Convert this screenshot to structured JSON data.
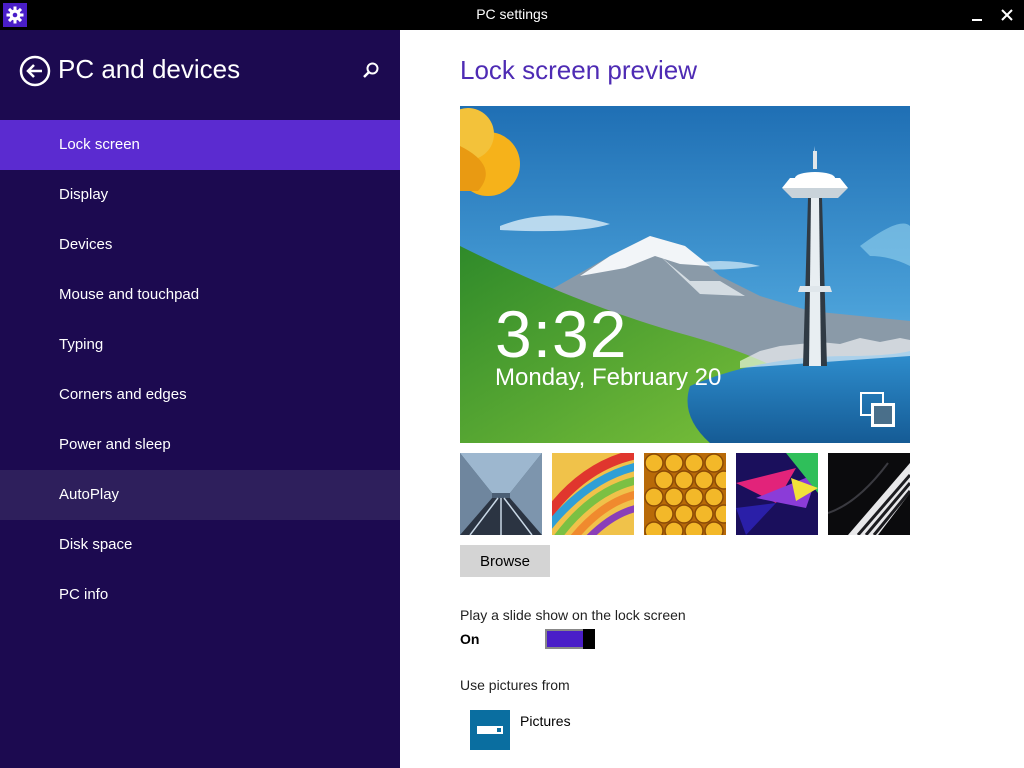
{
  "window": {
    "title": "PC settings",
    "app_icon": "gear-icon",
    "minimize_icon": "minimize-icon",
    "close_icon": "close-icon"
  },
  "sidebar": {
    "heading": "PC and devices",
    "back_icon": "back-arrow-icon",
    "search_icon": "search-icon",
    "items": [
      {
        "label": "Lock screen",
        "state": "selected"
      },
      {
        "label": "Display"
      },
      {
        "label": "Devices"
      },
      {
        "label": "Mouse and touchpad"
      },
      {
        "label": "Typing"
      },
      {
        "label": "Corners and edges"
      },
      {
        "label": "Power and sleep"
      },
      {
        "label": "AutoPlay",
        "state": "hover"
      },
      {
        "label": "Disk space"
      },
      {
        "label": "PC info"
      }
    ]
  },
  "main": {
    "section_title": "Lock screen preview",
    "preview": {
      "time": "3:32",
      "date": "Monday, February 20",
      "slideshow_icon": "slideshow-icon"
    },
    "thumbnails": [
      {
        "name": "tunnel"
      },
      {
        "name": "ribbons"
      },
      {
        "name": "honeycomb"
      },
      {
        "name": "prism"
      },
      {
        "name": "piano"
      }
    ],
    "browse_label": "Browse",
    "slideshow": {
      "label": "Play a slide show on the lock screen",
      "state_label": "On",
      "value": true
    },
    "pictures_from": {
      "label": "Use pictures from",
      "source_label": "Pictures",
      "source_icon": "drive-icon"
    }
  },
  "colors": {
    "sidebar_bg": "#1c0a50",
    "selected_item": "#5b2bd0",
    "hover_item": "#2e1f5c",
    "accent": "#4e2bb4",
    "toggle_on": "#4a1ec8",
    "drive_icon": "#0a6ea0"
  }
}
